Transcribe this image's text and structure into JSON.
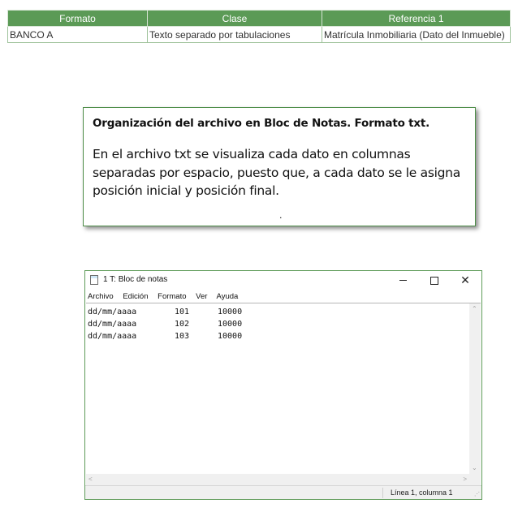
{
  "table": {
    "headers": [
      "Formato",
      "Clase",
      "Referencia 1"
    ],
    "rows": [
      [
        "BANCO A",
        "Texto separado por tabulaciones",
        "Matrícula Inmobiliaria (Dato del Inmueble)"
      ]
    ]
  },
  "note": {
    "title": "Organización  del archivo en Bloc de Notas. Formato txt.",
    "body": "En el archivo txt se visualiza cada dato en columnas separadas por espacio, puesto que, a cada dato se le asigna posición inicial y posición final.",
    "dot": "."
  },
  "notepad": {
    "title": "1 T: Bloc de notas",
    "menu": [
      "Archivo",
      "Edición",
      "Formato",
      "Ver",
      "Ayuda"
    ],
    "lines": [
      [
        "dd/mm/aaaa",
        "101",
        "10000"
      ],
      [
        "dd/mm/aaaa",
        "102",
        "10000"
      ],
      [
        "dd/mm/aaaa",
        "103",
        "10000"
      ]
    ],
    "status": "Línea 1, columna 1",
    "icons": [
      "notepad-icon",
      "minimize-icon",
      "maximize-icon",
      "close-icon",
      "scroll-up-icon",
      "scroll-down-icon",
      "scroll-left-icon",
      "scroll-right-icon",
      "resize-grip-icon"
    ]
  },
  "colors": {
    "header_green": "#5b9a56",
    "border_green": "#5e9b58"
  }
}
